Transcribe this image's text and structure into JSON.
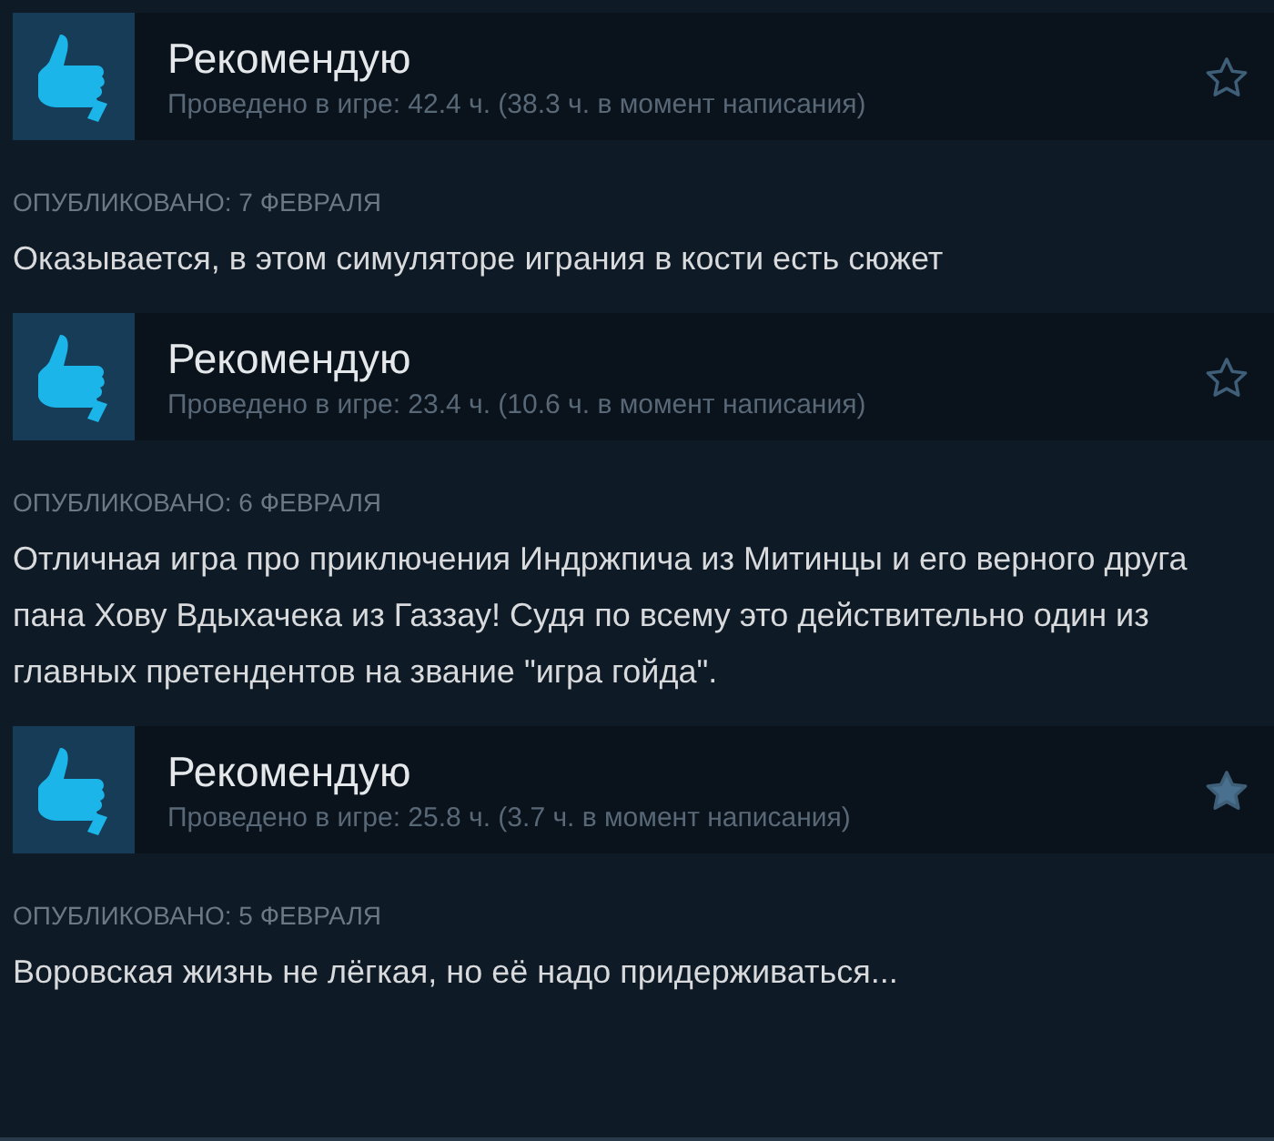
{
  "reviews": [
    {
      "verdict": "Рекомендую",
      "playtime": "Проведено в игре: 42.4 ч. (38.3 ч. в момент написания)",
      "starred": false,
      "posted": "ОПУБЛИКОВАНО: 7 ФЕВРАЛЯ",
      "text": "Оказывается, в этом симуляторе играния в кости есть сюжет"
    },
    {
      "verdict": "Рекомендую",
      "playtime": "Проведено в игре: 23.4 ч. (10.6 ч. в момент написания)",
      "starred": false,
      "posted": "ОПУБЛИКОВАНО: 6 ФЕВРАЛЯ",
      "text": "Отличная игра про приключения Индржпича из Митинцы и его верного друга пана Хову Вдыхачека из Газзау! Судя по всему это действительно один из главных претендентов на звание \"игра гойда\"."
    },
    {
      "verdict": "Рекомендую",
      "playtime": "Проведено в игре: 25.8 ч. (3.7 ч. в момент написания)",
      "starred": true,
      "posted": "ОПУБЛИКОВАНО: 5 ФЕВРАЛЯ",
      "text": "Воровская жизнь не лёгкая, но её надо придерживаться..."
    }
  ]
}
